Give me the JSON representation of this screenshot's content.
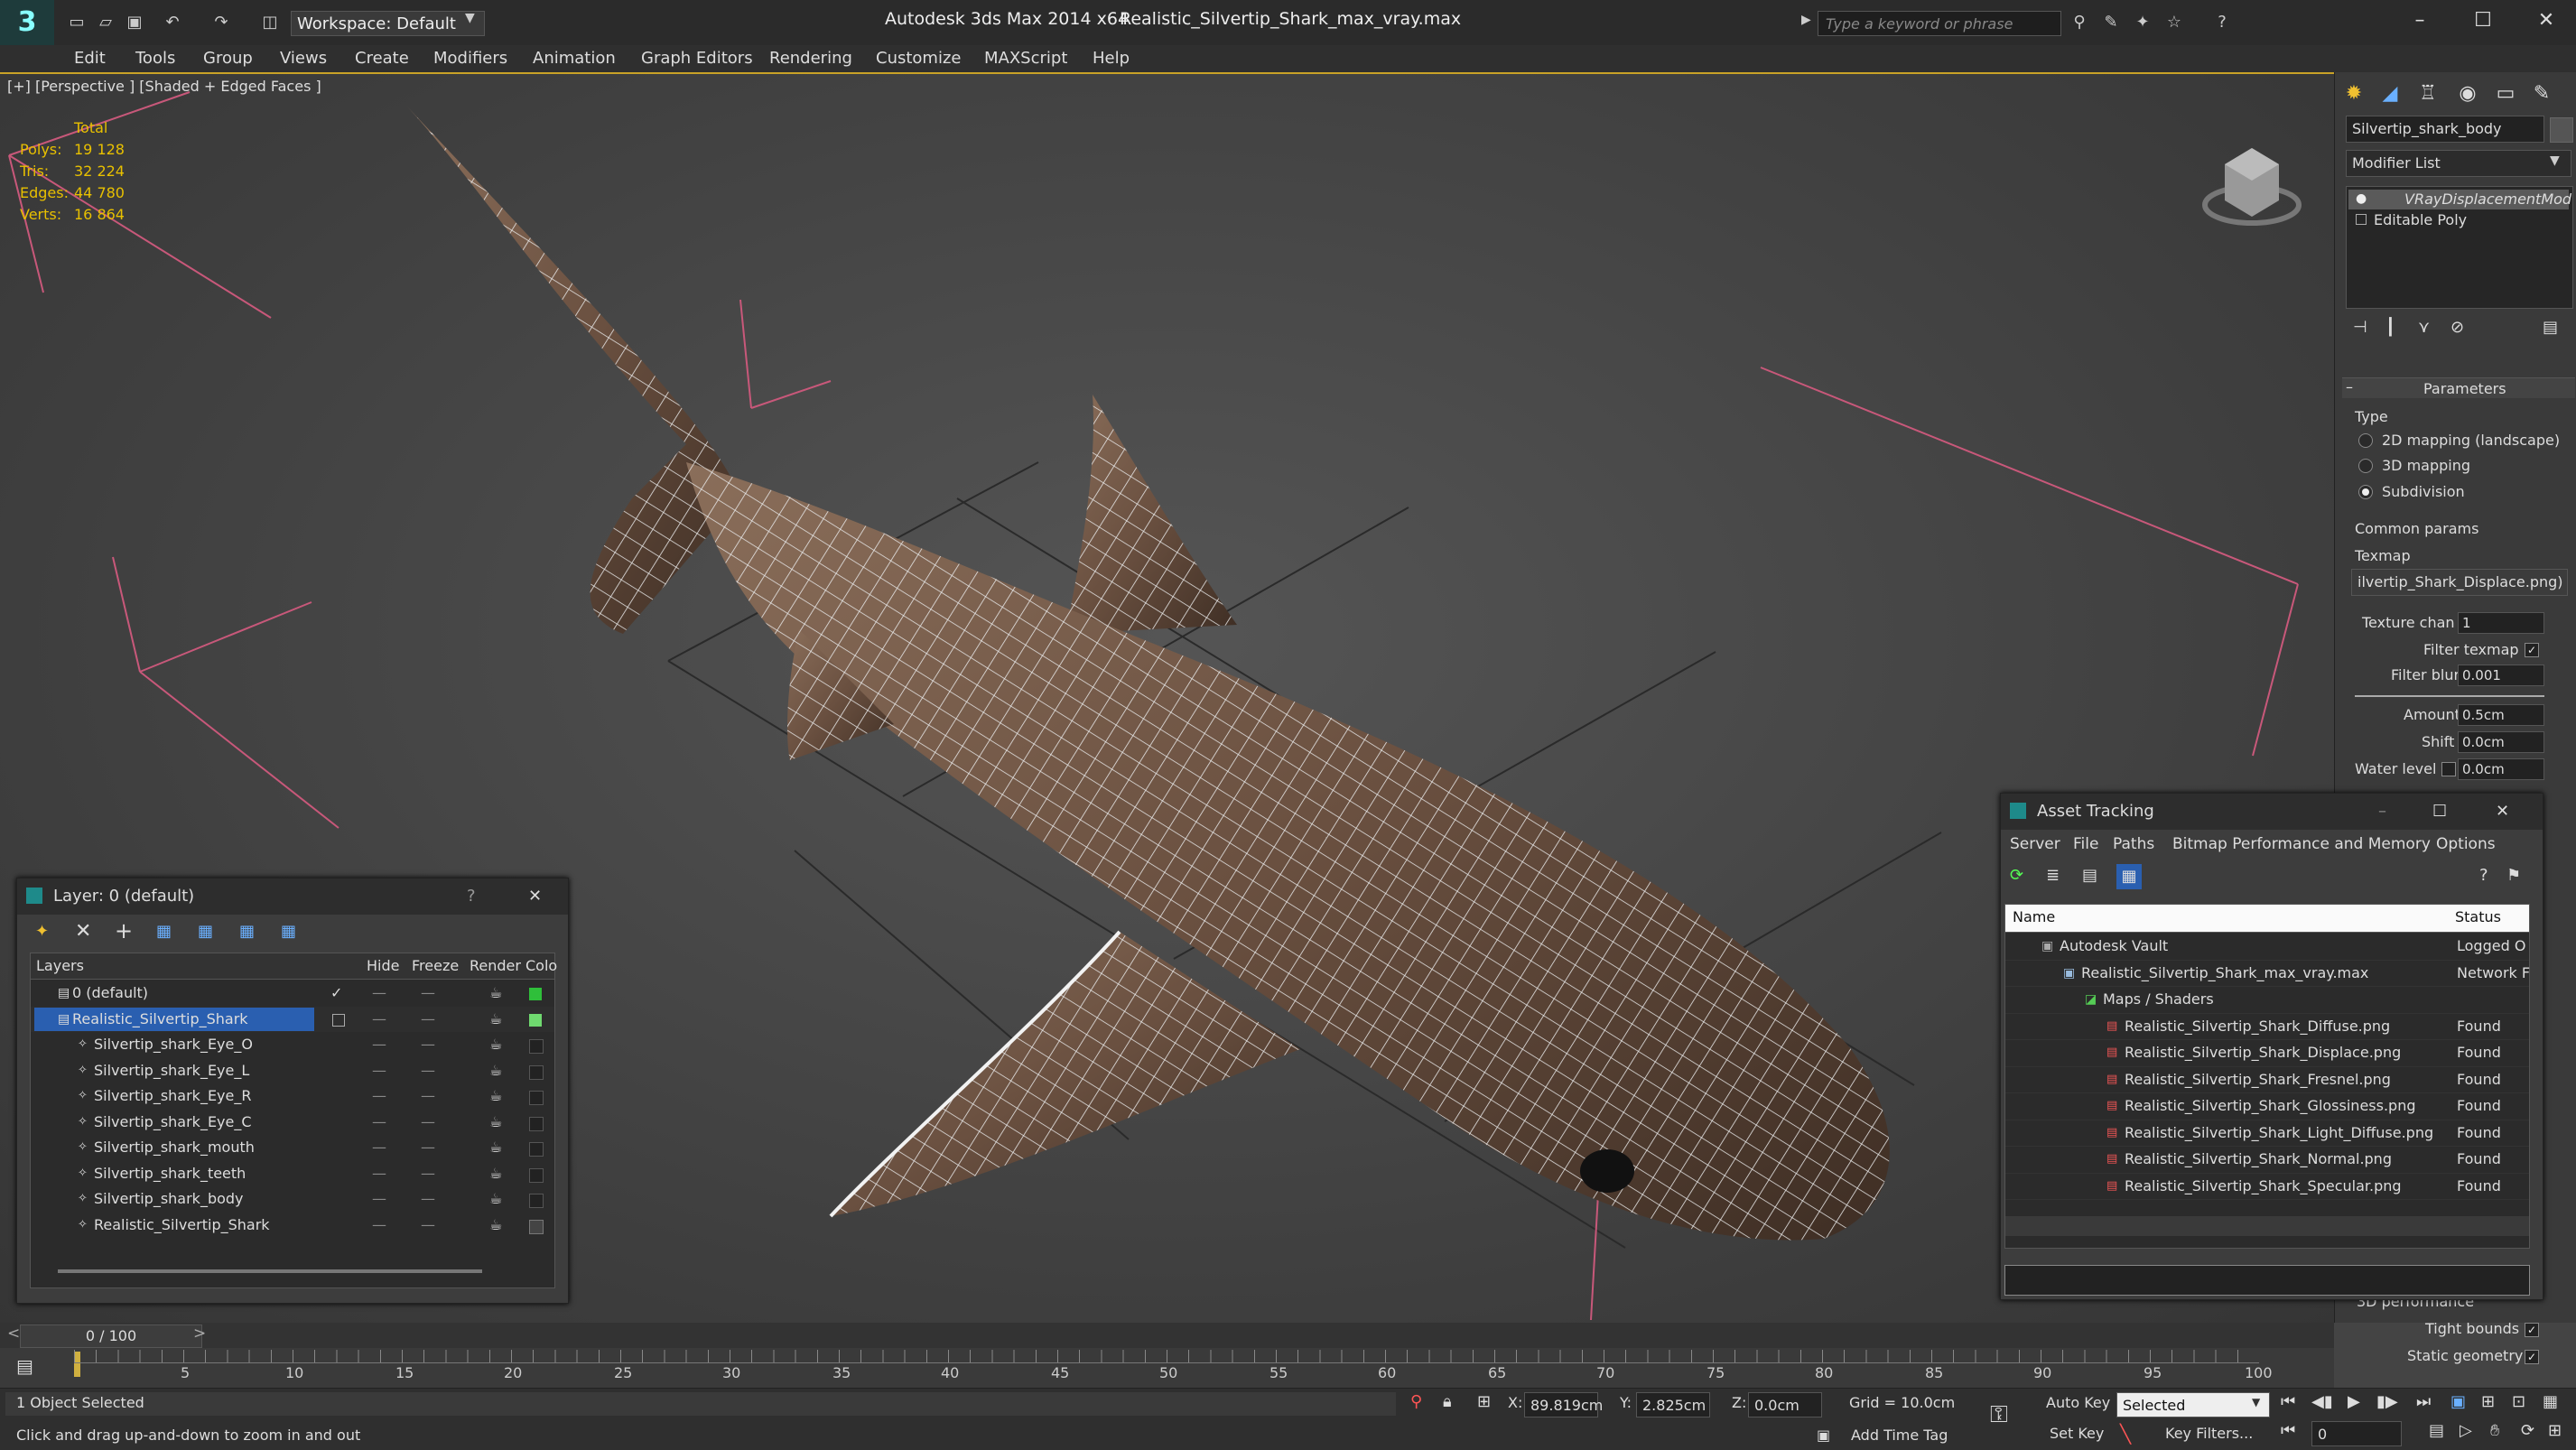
{
  "titlebar": {
    "app_title": "Autodesk 3ds Max  2014 x64",
    "document": "Realistic_Silvertip_Shark_max_vray.max",
    "workspace": "Workspace: Default",
    "search_placeholder": "Type a keyword or phrase",
    "logo": "3"
  },
  "menu": [
    "Edit",
    "Tools",
    "Group",
    "Views",
    "Create",
    "Modifiers",
    "Animation",
    "Graph Editors",
    "Rendering",
    "Customize",
    "MAXScript",
    "Help"
  ],
  "viewport": {
    "label": "[+] [Perspective ] [Shaded + Edged Faces ]",
    "stats": {
      "header": "Total",
      "rows": [
        {
          "label": "Polys:",
          "value": "19 128"
        },
        {
          "label": "Tris:",
          "value": "32 224"
        },
        {
          "label": "Edges:",
          "value": "44 780"
        },
        {
          "label": "Verts:",
          "value": "16 864"
        }
      ]
    }
  },
  "command_panel": {
    "object_name": "Silvertip_shark_body",
    "modifier_list": "Modifier List",
    "stack": [
      "VRayDisplacementMod",
      "Editable Poly"
    ],
    "rollout_title": "Parameters",
    "type_label": "Type",
    "type_options": [
      "2D mapping (landscape)",
      "3D mapping",
      "Subdivision"
    ],
    "common_params": "Common params",
    "texmap_label": "Texmap",
    "texmap_value": "ilvertip_Shark_Displace.png)",
    "texture_chan_label": "Texture chan",
    "texture_chan_value": "1",
    "filter_texmap_label": "Filter texmap",
    "filter_blur_label": "Filter blur",
    "filter_blur_value": "0.001",
    "amount_label": "Amount",
    "amount_value": "0.5cm",
    "shift_label": "Shift",
    "shift_value": "0.0cm",
    "water_level_label": "Water level",
    "water_level_value": "0.0cm",
    "perf_label": "3D performance",
    "tight_bounds_label": "Tight bounds",
    "static_geometry_label": "Static geometry"
  },
  "layer_dialog": {
    "title": "Layer: 0 (default)",
    "help": "?",
    "close": "✕",
    "columns": [
      "Layers",
      "Hide",
      "Freeze",
      "Render",
      "Colo"
    ],
    "rows": [
      {
        "name": "0 (default)",
        "color": "#2fbf3a",
        "indent": 0
      },
      {
        "name": "Realistic_Silvertip_Shark",
        "color": "#6fd96f",
        "indent": 0
      },
      {
        "name": "Silvertip_shark_Eye_O",
        "color": "#222222",
        "indent": 1
      },
      {
        "name": "Silvertip_shark_Eye_L",
        "color": "#222222",
        "indent": 1
      },
      {
        "name": "Silvertip_shark_Eye_R",
        "color": "#222222",
        "indent": 1
      },
      {
        "name": "Silvertip_shark_Eye_C",
        "color": "#222222",
        "indent": 1
      },
      {
        "name": "Silvertip_shark_mouth",
        "color": "#222222",
        "indent": 1
      },
      {
        "name": "Silvertip_shark_teeth",
        "color": "#222222",
        "indent": 1
      },
      {
        "name": "Silvertip_shark_body",
        "color": "#222222",
        "indent": 1
      },
      {
        "name": "Realistic_Silvertip_Shark",
        "color": "#444444",
        "indent": 1
      }
    ]
  },
  "asset_dialog": {
    "title": "Asset Tracking",
    "menu": [
      "Server",
      "File",
      "Paths",
      "Bitmap Performance and Memory",
      "Options"
    ],
    "columns": [
      "Name",
      "Status"
    ],
    "rows": [
      {
        "name": "Autodesk Vault",
        "status": "Logged O",
        "indent": 1
      },
      {
        "name": "Realistic_Silvertip_Shark_max_vray.max",
        "status": "Network F",
        "indent": 2
      },
      {
        "name": "Maps / Shaders",
        "status": "",
        "indent": 3
      },
      {
        "name": "Realistic_Silvertip_Shark_Diffuse.png",
        "status": "Found",
        "indent": 4
      },
      {
        "name": "Realistic_Silvertip_Shark_Displace.png",
        "status": "Found",
        "indent": 4
      },
      {
        "name": "Realistic_Silvertip_Shark_Fresnel.png",
        "status": "Found",
        "indent": 4
      },
      {
        "name": "Realistic_Silvertip_Shark_Glossiness.png",
        "status": "Found",
        "indent": 4
      },
      {
        "name": "Realistic_Silvertip_Shark_Light_Diffuse.png",
        "status": "Found",
        "indent": 4
      },
      {
        "name": "Realistic_Silvertip_Shark_Normal.png",
        "status": "Found",
        "indent": 4
      },
      {
        "name": "Realistic_Silvertip_Shark_Specular.png",
        "status": "Found",
        "indent": 4
      }
    ]
  },
  "timeline": {
    "frame": "0 / 100",
    "ticks": [
      "5",
      "10",
      "15",
      "20",
      "25",
      "30",
      "35",
      "40",
      "45",
      "50",
      "55",
      "60",
      "65",
      "70",
      "75",
      "80",
      "85",
      "90",
      "95",
      "100"
    ]
  },
  "status": {
    "selection": "1 Object Selected",
    "prompt": "Click and drag up-and-down to zoom in and out",
    "x_label": "X:",
    "x_value": "89.819cm",
    "y_label": "Y:",
    "y_value": "2.825cm",
    "z_label": "Z:",
    "z_value": "0.0cm",
    "grid": "Grid = 10.0cm",
    "add_time_tag": "Add Time Tag",
    "auto_key": "Auto Key",
    "set_key": "Set Key",
    "selected": "Selected",
    "key_filters": "Key Filters...",
    "frame_value": "0"
  }
}
